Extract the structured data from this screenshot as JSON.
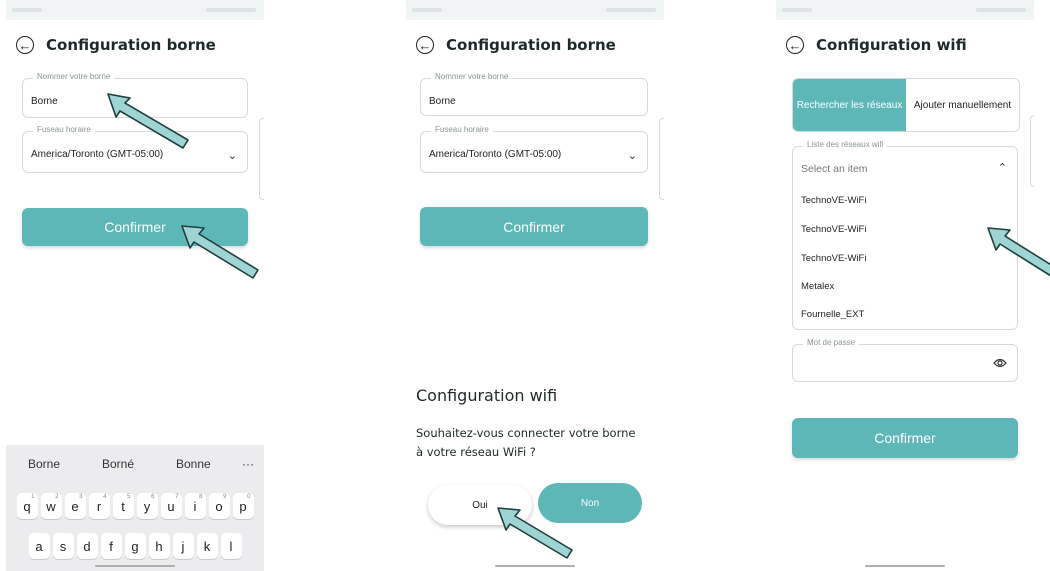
{
  "colors": {
    "accent": "#5eb7b7",
    "arrow_fill": "#9fd4d4",
    "arrow_stroke": "#1f3f3f"
  },
  "screen1": {
    "title": "Configuration borne",
    "name_field": {
      "legend": "Nommer votre borne",
      "value": "Borne"
    },
    "tz_field": {
      "legend": "Fuseau horaire",
      "value": "America/Toronto (GMT-05:00)"
    },
    "confirm_label": "Confirmer",
    "keyboard": {
      "suggestions": [
        "Borne",
        "Borné",
        "Bonne",
        "···"
      ],
      "row1": [
        "q",
        "w",
        "e",
        "r",
        "t",
        "y",
        "u",
        "i",
        "o",
        "p"
      ],
      "row1_hints": [
        "1",
        "2",
        "3",
        "4",
        "5",
        "6",
        "7",
        "8",
        "9",
        "0"
      ],
      "row2": [
        "a",
        "s",
        "d",
        "f",
        "g",
        "h",
        "j",
        "k",
        "l"
      ]
    }
  },
  "screen2": {
    "title": "Configuration borne",
    "name_field": {
      "legend": "Nommer votre borne",
      "value": "Borne"
    },
    "tz_field": {
      "legend": "Fuseau horaire",
      "value": "America/Toronto (GMT-05:00)"
    },
    "confirm_label": "Confirmer",
    "dialog": {
      "title": "Configuration wifi",
      "message": "Souhaitez-vous connecter votre borne à votre réseau WiFi ?",
      "yes": "Oui",
      "no": "Non"
    }
  },
  "screen3": {
    "title": "Configuration wifi",
    "tab_search": "Rechercher les réseaux",
    "tab_manual": "Ajouter manuellement",
    "list_legend": "Liste des réseaux wifi",
    "list_placeholder": "Select an item",
    "networks": [
      "TechnoVE-WiFi",
      "TechnoVE-WiFi",
      "TechnoVE-WiFi",
      "Metalex",
      "Fournelle_EXT"
    ],
    "password_legend": "Mot de passe",
    "confirm_label": "Confirmer"
  }
}
